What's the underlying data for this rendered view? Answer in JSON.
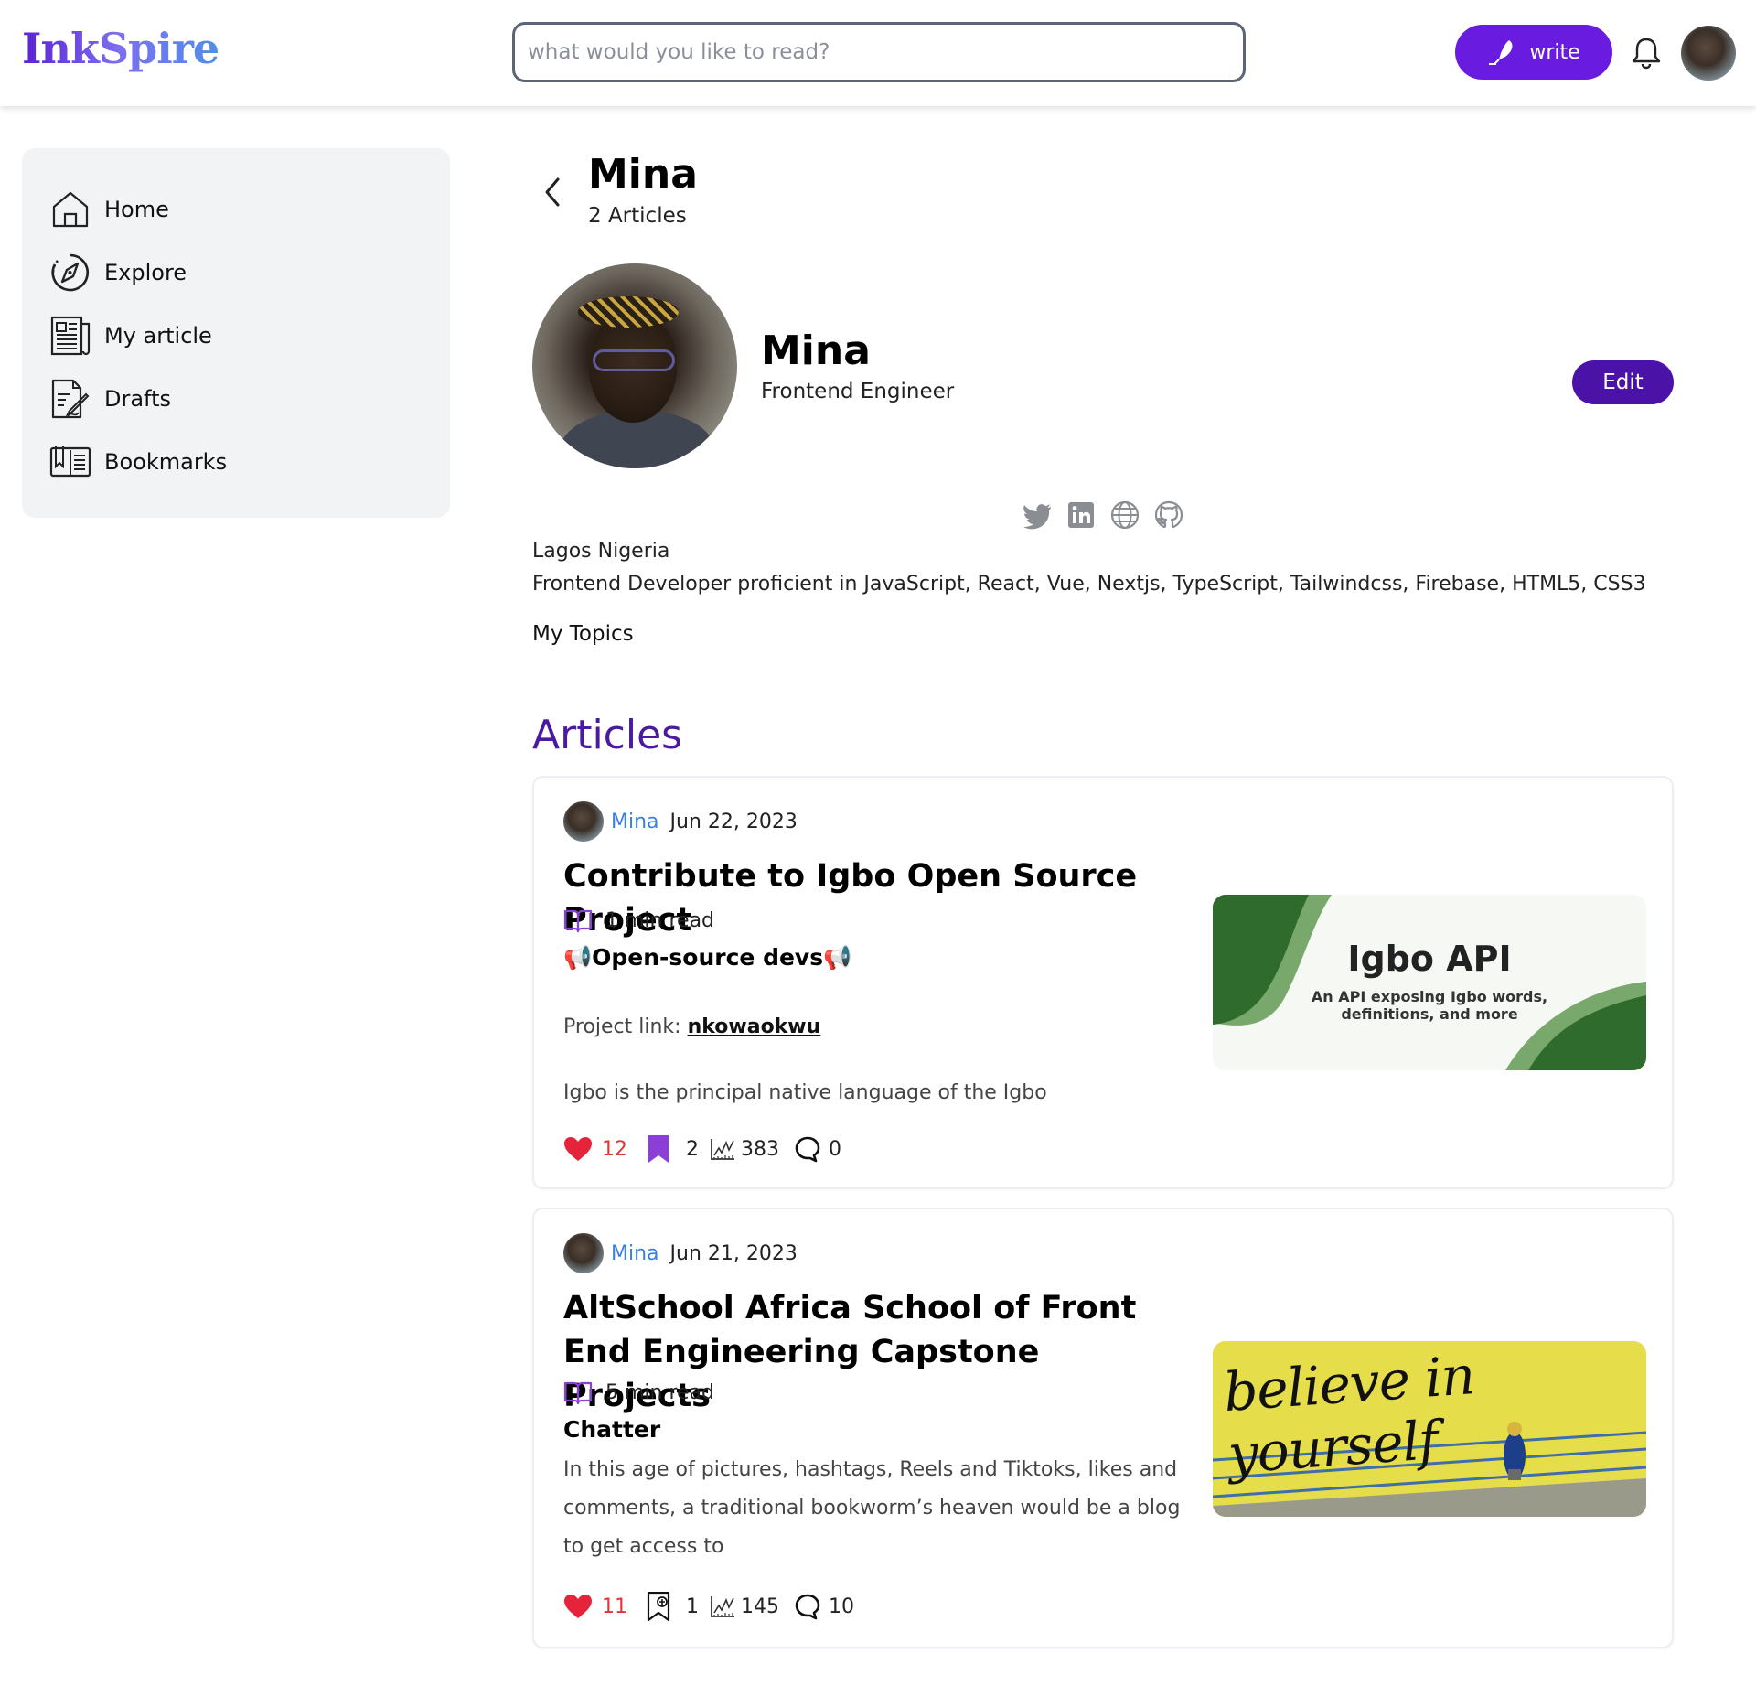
{
  "header": {
    "logo": "InkSpire",
    "search_placeholder": "what would you like to read?",
    "write_label": "write"
  },
  "sidebar": {
    "items": [
      {
        "label": "Home",
        "icon": "home-icon"
      },
      {
        "label": "Explore",
        "icon": "compass-icon"
      },
      {
        "label": "My article",
        "icon": "newspaper-icon"
      },
      {
        "label": "Drafts",
        "icon": "drafts-icon"
      },
      {
        "label": "Bookmarks",
        "icon": "bookmarks-icon"
      }
    ]
  },
  "profile": {
    "title": "Mina",
    "article_count": "2 Articles",
    "name": "Mina",
    "role": "Frontend Engineer",
    "edit_label": "Edit",
    "socials": [
      "twitter-icon",
      "linkedin-icon",
      "globe-icon",
      "github-icon"
    ],
    "location": "Lagos Nigeria",
    "bio": "Frontend Developer proficient in JavaScript, React, Vue, Nextjs, TypeScript, Tailwindcss, Firebase, HTML5, CSS3",
    "topics_label": "My Topics"
  },
  "articles_heading": "Articles",
  "articles": [
    {
      "author": "Mina",
      "date": "Jun 22, 2023",
      "title": "Contribute to Igbo Open Source Project",
      "read_time": "1 min read",
      "subhead": "📢Open-source devs📢",
      "link_prefix": "Project link: ",
      "link_text": "nkowaokwu",
      "excerpt": "Igbo is the principal native language of the Igbo",
      "likes": "12",
      "bookmarks": "2",
      "views": "383",
      "comments": "0",
      "bookmarked": true,
      "thumb_title": "Igbo API",
      "thumb_subtitle": "An API exposing Igbo words,\ndefinitions, and more"
    },
    {
      "author": "Mina",
      "date": "Jun 21, 2023",
      "title": "AltSchool Africa School of Front End Engineering Capstone Projects",
      "read_time": "5 min read",
      "subhead": "Chatter",
      "excerpt": "In this age of pictures, hashtags, Reels and Tiktoks, likes and comments, a traditional bookworm’s heaven would be a blog to get access to",
      "likes": "11",
      "bookmarks": "1",
      "views": "145",
      "comments": "10",
      "bookmarked": false,
      "thumb_text": "believe in yourself"
    }
  ],
  "colors": {
    "accent": "#6a1be0",
    "edit_button": "#4b12a8",
    "articles_heading": "#4b1aa0",
    "author_link": "#3a7fe0",
    "like_red": "#e23636"
  }
}
